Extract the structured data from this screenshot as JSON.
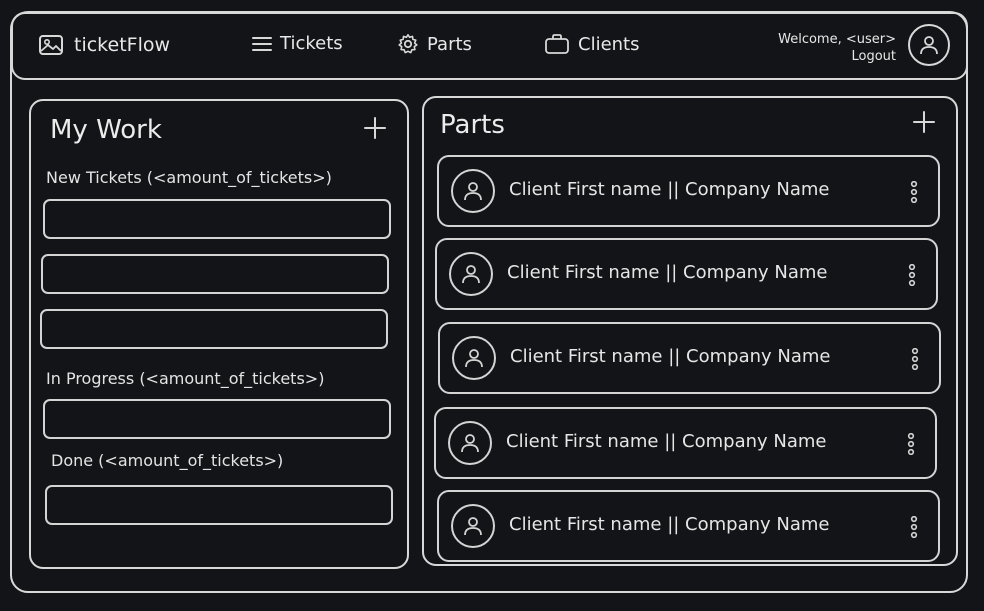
{
  "header": {
    "brand_name": "ticketFlow",
    "nav": [
      {
        "label": "Tickets",
        "icon": "menu-icon"
      },
      {
        "label": "Parts",
        "icon": "gear-icon"
      },
      {
        "label": "Clients",
        "icon": "briefcase-icon"
      }
    ],
    "welcome_text": "Welcome, <user>",
    "logout_label": "Logout"
  },
  "my_work": {
    "title": "My Work",
    "sections": [
      {
        "label": "New Tickets (<amount_of_tickets>)"
      },
      {
        "label": "In Progress (<amount_of_tickets>)"
      },
      {
        "label": "Done (<amount_of_tickets>)"
      }
    ]
  },
  "parts": {
    "title": "Parts",
    "items": [
      {
        "label": "Client First name || Company Name"
      },
      {
        "label": "Client First name || Company Name"
      },
      {
        "label": "Client First name || Company Name"
      },
      {
        "label": "Client First name || Company Name"
      },
      {
        "label": "Client First name || Company Name"
      }
    ]
  },
  "colors": {
    "background": "#121417",
    "stroke": "#d8d8d8",
    "text": "#e6e6e6"
  }
}
